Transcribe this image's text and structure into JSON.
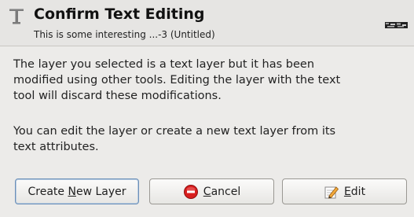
{
  "dialog": {
    "title": "Confirm Text Editing",
    "subtitle": "This is some interesting ...-3 (Untitled)",
    "title_icon": "text-tool-icon",
    "thumbnail": "image-thumbnail",
    "message_1": "The layer you selected is a text layer but it has been\nmodified using other tools. Editing the layer with the text\ntool will discard these modifications.",
    "message_2": "You can edit the layer or create a new text layer from its\ntext attributes."
  },
  "buttons": {
    "create_new_layer": {
      "pre": "Create ",
      "mnemonic": "N",
      "post": "ew Layer"
    },
    "cancel": {
      "mnemonic": "C",
      "post": "ancel",
      "icon": "stop-icon",
      "icon_color": "#d81e1e"
    },
    "edit": {
      "mnemonic": "E",
      "post": "dit",
      "icon": "pencil-icon"
    }
  },
  "colors": {
    "background": "#ecebe9",
    "focus_border": "#6b8fb8"
  }
}
